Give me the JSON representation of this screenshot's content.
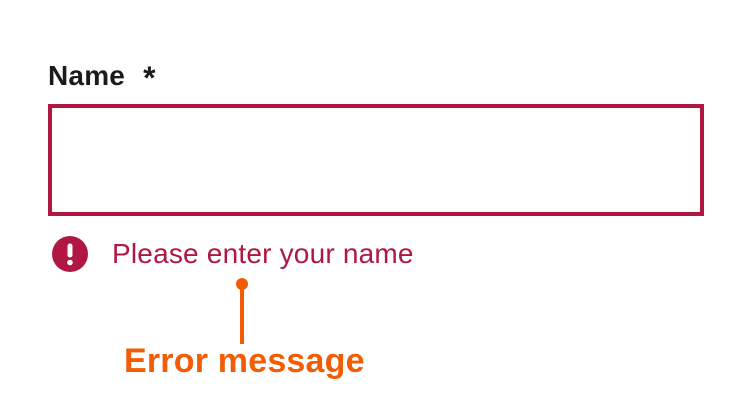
{
  "form": {
    "field_label": "Name",
    "required_marker": "*",
    "input_value": "",
    "error_message": "Please enter your name"
  },
  "annotation": {
    "label": "Error message"
  },
  "colors": {
    "error": "#b01742",
    "annotation": "#f25c05",
    "text": "#1b1b1b"
  },
  "icons": {
    "error": "exclamation-circle-icon"
  }
}
